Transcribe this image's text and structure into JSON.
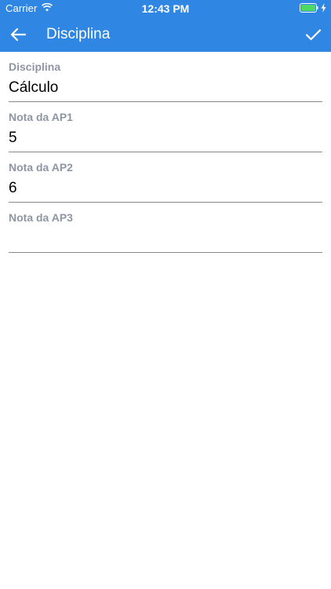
{
  "status_bar": {
    "carrier": "Carrier",
    "time": "12:43 PM",
    "wifi_icon": "wifi-icon",
    "battery_icon": "battery-icon",
    "charging_icon": "bolt-icon"
  },
  "app_bar": {
    "title": "Disciplina",
    "back_icon": "arrow-left-icon",
    "confirm_icon": "check-icon",
    "background_color": "#2f86e3"
  },
  "form": {
    "fields": [
      {
        "label": "Disciplina",
        "value": "Cálculo"
      },
      {
        "label": "Nota da AP1",
        "value": "5"
      },
      {
        "label": "Nota da AP2",
        "value": "6"
      },
      {
        "label": "Nota da AP3",
        "value": ""
      }
    ],
    "label_color": "#8e96a3",
    "divider_color": "#8a8a8a"
  }
}
